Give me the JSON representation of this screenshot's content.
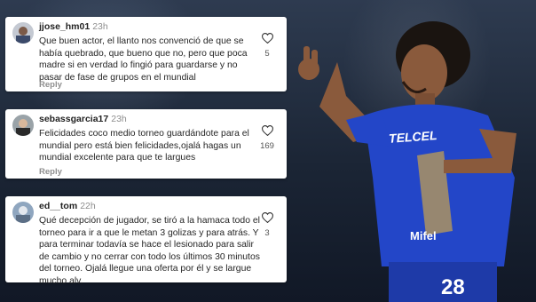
{
  "comments": [
    {
      "username": "jjose_hm01",
      "time": "23h",
      "text": "Que buen actor, el llanto nos convenció de que se había quebrado, que bueno que no, pero que poca madre si en verdad lo fingió para guardarse y no pasar de fase de grupos en el mundial",
      "likes": "5",
      "reply_label": "Reply"
    },
    {
      "username": "sebassgarcia17",
      "time": "23h",
      "text": "Felicidades coco medio torneo guardándote para el mundial pero está bien felicidades,ojalá hagas un mundial excelente para que te largues",
      "likes": "169",
      "reply_label": "Reply"
    },
    {
      "username": "ed__tom",
      "time": "22h",
      "text": "Qué decepción de jugador, se tiró a la hamaca todo el torneo para ir a que le metan 3 golizas y para atrás. Y para terminar todavía se hace el lesionado para salir de cambio y no cerrar con todo los últimos 30 minutos del torneo. Ojalá llegue una oferta por él y se largue mucho alv.",
      "likes": "3"
    }
  ],
  "jersey": {
    "sponsor_chest": "Mifel",
    "sponsor_top": "TELCEL",
    "number": "28"
  },
  "colors": {
    "jersey_blue": "#2346c8",
    "jersey_gold": "#c9a24a",
    "card_bg": "#ffffff"
  }
}
